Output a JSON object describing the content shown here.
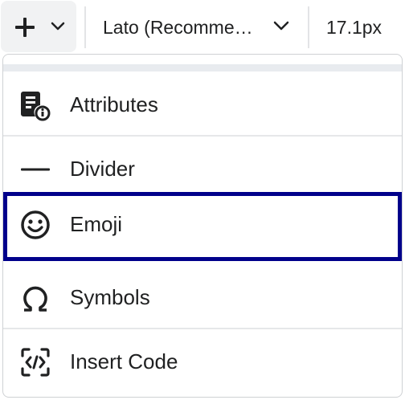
{
  "toolbar": {
    "insert_button": {
      "icon": "plus-icon",
      "dropdown_icon": "chevron-down-icon"
    },
    "font_family": {
      "value": "Lato (Recomme…",
      "dropdown_icon": "chevron-down-icon"
    },
    "font_size": {
      "value": "17.1px"
    }
  },
  "menu": {
    "items": [
      {
        "label": "Attributes",
        "icon": "attributes-icon",
        "selected": false
      },
      {
        "label": "Divider",
        "icon": "divider-icon",
        "selected": false
      },
      {
        "label": "Emoji",
        "icon": "emoji-icon",
        "selected": true
      },
      {
        "label": "Symbols",
        "icon": "omega-icon",
        "selected": false
      },
      {
        "label": "Insert Code",
        "icon": "code-icon",
        "selected": false
      }
    ]
  },
  "colors": {
    "selection_outline": "#00008b",
    "text": "#202122",
    "button_bg": "#f1f2f3",
    "divider": "#e6e7e9"
  }
}
